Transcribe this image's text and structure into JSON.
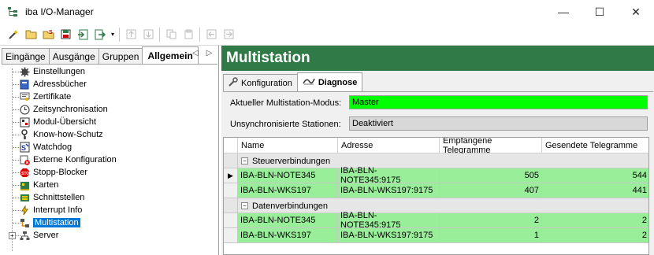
{
  "window": {
    "title": "iba I/O-Manager",
    "minimize": "—",
    "maximize": "☐",
    "close": "✕"
  },
  "toolbar": {
    "icons": [
      "new-wand-icon",
      "open-folder-icon",
      "open-sfolder-icon",
      "save-disk-icon",
      "import-icon",
      "export-icon",
      "dropdown-arrow-icon",
      "move-up-icon",
      "move-down-icon",
      "copy-icon",
      "paste-icon",
      "back-icon",
      "forward-icon"
    ]
  },
  "left": {
    "tabs": [
      "Eingänge",
      "Ausgänge",
      "Gruppen",
      "Allgemein"
    ],
    "active_tab": "Allgemein",
    "nav_prev": "◁",
    "nav_next": "▷",
    "tree": [
      {
        "label": "Einstellungen",
        "icon": "gear-icon"
      },
      {
        "label": "Adressbücher",
        "icon": "book-icon"
      },
      {
        "label": "Zertifikate",
        "icon": "certificate-icon"
      },
      {
        "label": "Zeitsynchronisation",
        "icon": "clock-icon"
      },
      {
        "label": "Modul-Übersicht",
        "icon": "module-icon"
      },
      {
        "label": "Know-how-Schutz",
        "icon": "key-icon"
      },
      {
        "label": "Watchdog",
        "icon": "watchdog-icon"
      },
      {
        "label": "Externe Konfiguration",
        "icon": "external-config-icon"
      },
      {
        "label": "Stopp-Blocker",
        "icon": "stop-icon"
      },
      {
        "label": "Karten",
        "icon": "card-icon"
      },
      {
        "label": "Schnittstellen",
        "icon": "interface-icon"
      },
      {
        "label": "Interrupt Info",
        "icon": "interrupt-icon"
      },
      {
        "label": "Multistation",
        "icon": "multistation-icon",
        "selected": true
      },
      {
        "label": "Server",
        "icon": "server-icon",
        "expandable": true
      }
    ],
    "expand_sign": "+"
  },
  "right": {
    "header": "Multistation",
    "tabs": [
      {
        "label": "Konfiguration",
        "icon": "config-icon"
      },
      {
        "label": "Diagnose",
        "icon": "diagnose-icon",
        "active": true
      }
    ],
    "mode_label": "Aktueller Multistation-Modus:",
    "mode_value": "Master",
    "unsync_label": "Unsynchronisierte Stationen:",
    "unsync_value": "Deaktiviert",
    "colors": {
      "mode_bg": "#00ff00",
      "row_bg": "#99ee99",
      "header_bg": "#2f7a46"
    },
    "grid": {
      "columns": [
        "Name",
        "Adresse",
        "Empfangene Telegramme",
        "Gesendete Telegramme"
      ],
      "groups": [
        {
          "name": "Steuerverbindungen",
          "collapse_sign": "−",
          "rows": [
            {
              "name": "IBA-BLN-NOTE345",
              "address": "IBA-BLN-NOTE345:9175",
              "received": "505",
              "sent": "544",
              "current": true
            },
            {
              "name": "IBA-BLN-WKS197",
              "address": "IBA-BLN-WKS197:9175",
              "received": "407",
              "sent": "441"
            }
          ]
        },
        {
          "name": "Datenverbindungen",
          "collapse_sign": "−",
          "rows": [
            {
              "name": "IBA-BLN-NOTE345",
              "address": "IBA-BLN-NOTE345:9175",
              "received": "2",
              "sent": "2"
            },
            {
              "name": "IBA-BLN-WKS197",
              "address": "IBA-BLN-WKS197:9175",
              "received": "1",
              "sent": "2"
            }
          ]
        }
      ],
      "row_pointer": "▶"
    }
  }
}
